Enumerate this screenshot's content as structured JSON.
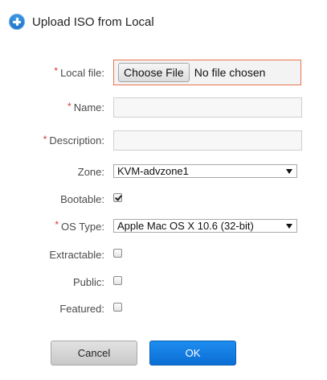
{
  "dialog": {
    "title": "Upload ISO from Local"
  },
  "form": {
    "local_file": {
      "label": "Local file:",
      "required": "*",
      "button": "Choose File",
      "status": "No file chosen"
    },
    "name": {
      "label": "Name:",
      "required": "*",
      "value": ""
    },
    "description": {
      "label": "Description:",
      "required": "*",
      "value": ""
    },
    "zone": {
      "label": "Zone:",
      "selected": "KVM-advzone1"
    },
    "bootable": {
      "label": "Bootable:",
      "checked": true
    },
    "os_type": {
      "label": "OS Type:",
      "required": "*",
      "selected": "Apple Mac OS X 10.6 (32-bit)"
    },
    "extractable": {
      "label": "Extractable:",
      "checked": false
    },
    "public": {
      "label": "Public:",
      "checked": false
    },
    "featured": {
      "label": "Featured:",
      "checked": false
    }
  },
  "buttons": {
    "cancel": "Cancel",
    "ok": "OK"
  },
  "colors": {
    "accent": "#0b6fd4",
    "required": "#d9362b",
    "focus_border": "#e9754f"
  }
}
